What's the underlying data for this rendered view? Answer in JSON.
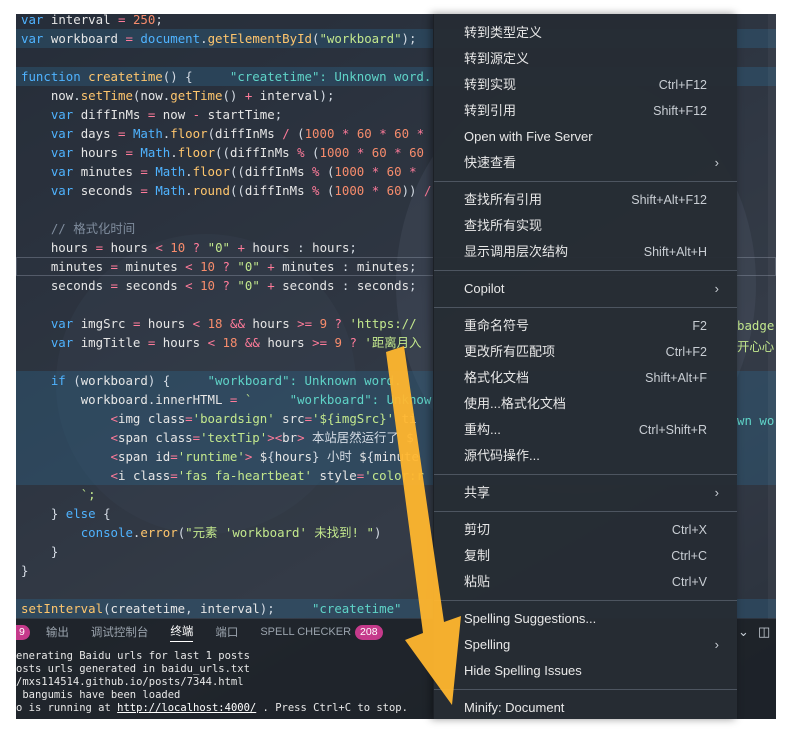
{
  "editor": {
    "lines": [
      {
        "kind": "plain",
        "text": "var interval = 250;"
      },
      {
        "kind": "plain",
        "text": "var workboard = document.getElementById(\"workboard\");"
      },
      {
        "kind": "plain",
        "text": ""
      },
      {
        "kind": "plain",
        "text": "function createtime() {     \"createtime\": Unknown word."
      },
      {
        "kind": "plain",
        "text": "    now.setTime(now.getTime() + interval);"
      },
      {
        "kind": "plain",
        "text": "    var diffInMs = now - startTime;"
      },
      {
        "kind": "plain",
        "text": "    var days = Math.floor(diffInMs / (1000 * 60 * 60 *"
      },
      {
        "kind": "plain",
        "text": "    var hours = Math.floor((diffInMs % (1000 * 60 * 60"
      },
      {
        "kind": "plain",
        "text": "    var minutes = Math.floor((diffInMs % (1000 * 60 *"
      },
      {
        "kind": "plain",
        "text": "    var seconds = Math.round((diffInMs % (1000 * 60)) /"
      },
      {
        "kind": "plain",
        "text": ""
      },
      {
        "kind": "plain",
        "text": "    // 格式化时间"
      },
      {
        "kind": "plain",
        "text": "    hours = hours < 10 ? \"0\" + hours : hours;"
      },
      {
        "kind": "plain",
        "text": "    minutes = minutes < 10 ? \"0\" + minutes : minutes;"
      },
      {
        "kind": "plain",
        "text": "    seconds = seconds < 10 ? \"0\" + seconds : seconds;"
      },
      {
        "kind": "plain",
        "text": ""
      },
      {
        "kind": "plain",
        "text": "    var imgSrc = hours < 18 && hours >= 9 ? 'https://"
      },
      {
        "kind": "plain",
        "text": "    var imgTitle = hours < 18 && hours >= 9 ? '距离月入"
      },
      {
        "kind": "plain",
        "text": ""
      },
      {
        "kind": "plain",
        "text": "    if (workboard) {     \"workboard\": Unknown word."
      },
      {
        "kind": "plain",
        "text": "        workboard.innerHTML = `     \"workboard\": Unknow"
      },
      {
        "kind": "plain",
        "text": "            <img class='boardsign' src='${imgSrc}' ti"
      },
      {
        "kind": "plain",
        "text": "            <span class='textTip'><br> 本站居然运行了 $"
      },
      {
        "kind": "plain",
        "text": "            <span id='runtime'> ${hours} 小时 ${minute"
      },
      {
        "kind": "plain",
        "text": "            <i class='fas fa-heartbeat' style='color:r"
      },
      {
        "kind": "plain",
        "text": "        `;"
      },
      {
        "kind": "plain",
        "text": "    } else {"
      },
      {
        "kind": "plain",
        "text": "        console.error(\"元素 'workboard' 未找到! \")"
      },
      {
        "kind": "plain",
        "text": "    }"
      },
      {
        "kind": "plain",
        "text": "}"
      },
      {
        "kind": "plain",
        "text": ""
      },
      {
        "kind": "plain",
        "text": "setInterval(createtime, interval);     \"createtime\""
      }
    ],
    "right_fragments": {
      "badge": "badge",
      "heart": "开心心",
      "unknown": "wn wo"
    }
  },
  "panel": {
    "left_count": "9",
    "tabs": [
      "输出",
      "调试控制台",
      "终端",
      "端口",
      "SPELL CHECKER"
    ],
    "active_tab": "终端",
    "spell_count": "208",
    "terminal_lines": [
      "enerating Baidu urls for last 1 posts",
      "osts urls generated in baidu_urls.txt",
      "/mxs114514.github.io/posts/7344.html",
      " bangumis have been loaded",
      "o is running at "
    ],
    "terminal_link": "http://localhost:4000/",
    "terminal_tail": " . Press Ctrl+C to stop."
  },
  "menu": {
    "groups": [
      [
        {
          "label": "转到类型定义",
          "key": ""
        },
        {
          "label": "转到源定义",
          "key": ""
        },
        {
          "label": "转到实现",
          "key": "Ctrl+F12"
        },
        {
          "label": "转到引用",
          "key": "Shift+F12"
        },
        {
          "label": "Open with Five Server",
          "key": ""
        },
        {
          "label": "快速查看",
          "key": "",
          "submenu": true
        }
      ],
      [
        {
          "label": "查找所有引用",
          "key": "Shift+Alt+F12"
        },
        {
          "label": "查找所有实现",
          "key": ""
        },
        {
          "label": "显示调用层次结构",
          "key": "Shift+Alt+H"
        }
      ],
      [
        {
          "label": "Copilot",
          "key": "",
          "submenu": true
        }
      ],
      [
        {
          "label": "重命名符号",
          "key": "F2"
        },
        {
          "label": "更改所有匹配项",
          "key": "Ctrl+F2"
        },
        {
          "label": "格式化文档",
          "key": "Shift+Alt+F"
        },
        {
          "label": "使用...格式化文档",
          "key": ""
        },
        {
          "label": "重构...",
          "key": "Ctrl+Shift+R"
        },
        {
          "label": "源代码操作...",
          "key": ""
        }
      ],
      [
        {
          "label": "共享",
          "key": "",
          "submenu": true
        }
      ],
      [
        {
          "label": "剪切",
          "key": "Ctrl+X"
        },
        {
          "label": "复制",
          "key": "Ctrl+C"
        },
        {
          "label": "粘贴",
          "key": "Ctrl+V"
        }
      ],
      [
        {
          "label": "Spelling Suggestions...",
          "key": ""
        },
        {
          "label": "Spelling",
          "key": "",
          "submenu": true
        },
        {
          "label": "Hide Spelling Issues",
          "key": ""
        }
      ],
      [
        {
          "label": "Minify: Document",
          "key": ""
        }
      ]
    ],
    "submenu_glyph": "›"
  },
  "colors": {
    "keyword": "#4fb3ff",
    "function": "#ffc66d",
    "string": "#c3e88d",
    "arrow": "#ffb62e",
    "badge": "#c53a8b"
  },
  "icons": [
    "chevron-down-icon",
    "split-editor-icon",
    "submenu-chevron-icon",
    "yellow-arrow-annotation"
  ]
}
